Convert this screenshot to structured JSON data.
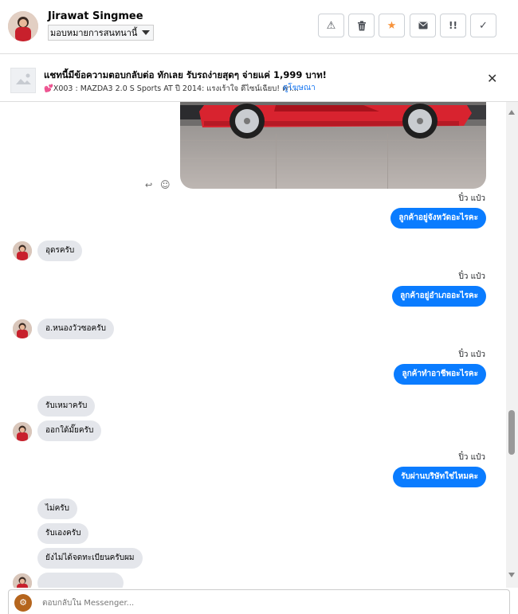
{
  "header": {
    "name": "Jirawat Singmee",
    "assign_label": "มอบหมายการสนทนานี้",
    "buttons": [
      {
        "name": "warning-icon",
        "glyph": "⚠"
      },
      {
        "name": "trash-icon",
        "glyph": "🗑"
      },
      {
        "name": "star-icon",
        "glyph": "★"
      },
      {
        "name": "envelope-icon",
        "glyph": "✉"
      },
      {
        "name": "important-icon",
        "glyph": "!!"
      },
      {
        "name": "check-icon",
        "glyph": "✓"
      }
    ]
  },
  "banner": {
    "title": "แชทนี้มีข้อความตอบกลับต่อ ทักเลย รับรถง่ายสุดๆ จ่ายแค่ 1,999 บาท!",
    "desc": "💕X003 : MAZDA3 2.0 S Sports AT ปี 2014: แรงเร้าใจ ดีไซน์เฉียบ! ค่า...",
    "link": "ดูโฆษณา"
  },
  "messages": {
    "seen_label": "ปิ๋ว แป๋ว",
    "out_1": "ลูกค้าอยู่จังหวัดอะไรคะ",
    "in_1": "อุดรครับ",
    "out_2": "ลูกค้าอยู่อำเภออะไรคะ",
    "in_2": "อ.หนองวัวซอครับ",
    "out_3": "ลูกค้าทำอาชีพอะไรคะ",
    "in_3a": "รับเหมาครับ",
    "in_3b": "ออกใด้มั๊ยครับ",
    "out_4": "รับผ่านบริษัทใช่ไหมคะ",
    "in_4a": "ไม่ครับ",
    "in_4b": "รับเองครับ",
    "in_4c": "ยังไม่ได้จดทะเบียนครับผม"
  },
  "composer": {
    "placeholder": "ตอบกลับใน Messenger..."
  },
  "colors": {
    "accent": "#0a7cff",
    "incoming_bubble": "#e4e6eb",
    "car": "#d8232f",
    "star": "#f7923a"
  }
}
